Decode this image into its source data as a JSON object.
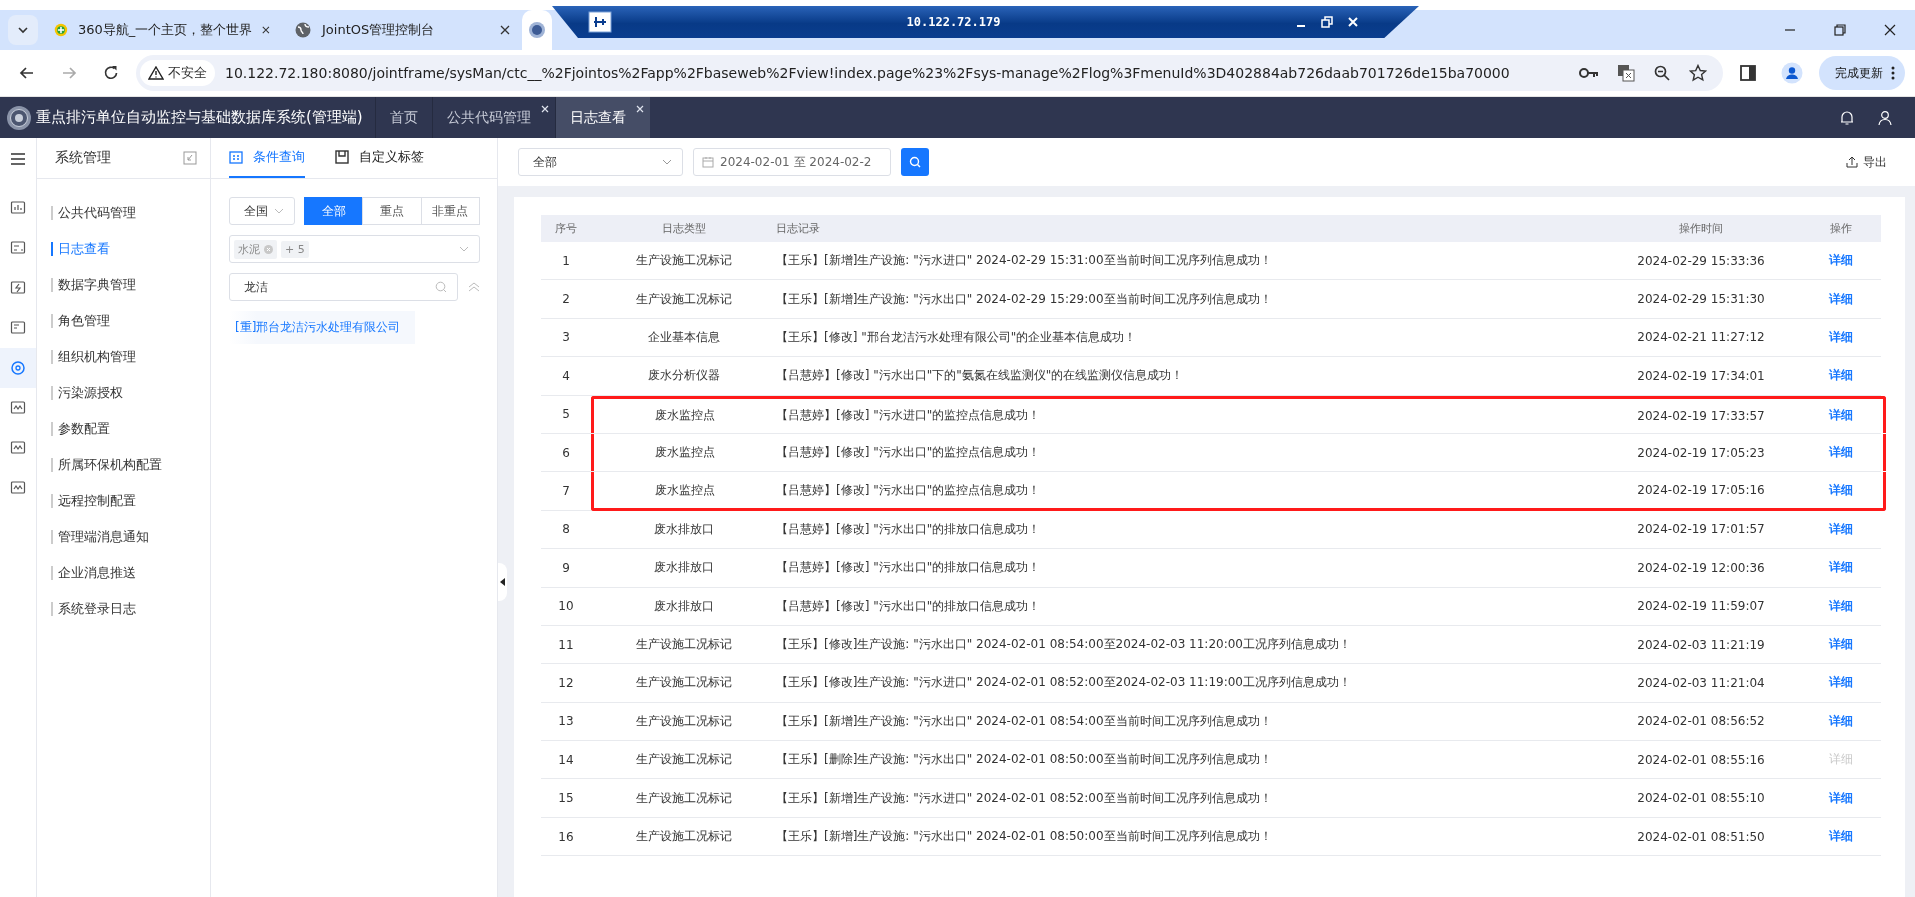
{
  "browser": {
    "tabs": [
      {
        "title": "360导航_一个主页，整个世界",
        "selected": false
      },
      {
        "title": "JointOS管理控制台",
        "selected": false
      },
      {
        "selected": true
      }
    ],
    "remote_bar": {
      "title": "10.122.72.179"
    },
    "address": {
      "security": "不安全",
      "url": "10.122.72.180:8080/jointframe/sysMan/ctc__%2Fjointos%2Fapp%2Fbaseweb%2Fview!index.page%23%2Fsys-manage%2Flog%3FmenuId%3D402884ab726daab701726de15ba70000"
    },
    "update_button": "完成更新"
  },
  "app": {
    "title": "重点排污单位自动监控与基础数据库系统(管理端)",
    "nav_tabs": [
      {
        "label": "首页",
        "closable": false,
        "selected": false
      },
      {
        "label": "公共代码管理",
        "closable": true,
        "selected": false
      },
      {
        "label": "日志查看",
        "closable": true,
        "selected": true
      }
    ]
  },
  "icon_rail": [
    {
      "selected": false
    },
    {
      "selected": false
    },
    {
      "selected": false
    },
    {
      "selected": false
    },
    {
      "selected": true
    },
    {
      "selected": false
    },
    {
      "selected": false
    },
    {
      "selected": false
    }
  ],
  "sidebar": {
    "title": "系统管理",
    "items": [
      {
        "label": "公共代码管理",
        "selected": false
      },
      {
        "label": "日志查看",
        "selected": true
      },
      {
        "label": "数据字典管理",
        "selected": false
      },
      {
        "label": "角色管理",
        "selected": false
      },
      {
        "label": "组织机构管理",
        "selected": false
      },
      {
        "label": "污染源授权",
        "selected": false
      },
      {
        "label": "参数配置",
        "selected": false
      },
      {
        "label": "所属环保机构配置",
        "selected": false
      },
      {
        "label": "远程控制配置",
        "selected": false
      },
      {
        "label": "管理端消息通知",
        "selected": false
      },
      {
        "label": "企业消息推送",
        "selected": false
      },
      {
        "label": "系统登录日志",
        "selected": false
      }
    ]
  },
  "filter_panel": {
    "tabs": [
      {
        "label": "条件查询",
        "selected": true
      },
      {
        "label": "自定义标签",
        "selected": false
      }
    ],
    "region": "全国",
    "segments": [
      {
        "label": "全部",
        "selected": true
      },
      {
        "label": "重点",
        "selected": false
      },
      {
        "label": "非重点",
        "selected": false
      }
    ],
    "tags": [
      {
        "label": "水泥"
      }
    ],
    "more_tags": "+ 5",
    "search": {
      "value": "龙洁"
    },
    "results": [
      {
        "label": "[重]邢台龙洁污水处理有限公司"
      }
    ]
  },
  "toolbar": {
    "type_select": "全部",
    "date_range": "2024-02-01 至 2024-02-2",
    "export": "导出"
  },
  "table": {
    "columns": [
      "序号",
      "日志类型",
      "日志记录",
      "操作时间",
      "操作"
    ],
    "rows": [
      {
        "no": "1",
        "type": "生产设施工况标记",
        "record": "【王乐】[新增]生产设施: \"污水进口\" 2024-02-29 15:31:00至当前时间工况序列信息成功！",
        "time": "2024-02-29 15:33:36",
        "action": "详细",
        "disabled": false,
        "highlighted": false
      },
      {
        "no": "2",
        "type": "生产设施工况标记",
        "record": "【王乐】[新增]生产设施: \"污水出口\" 2024-02-29 15:29:00至当前时间工况序列信息成功！",
        "time": "2024-02-29 15:31:30",
        "action": "详细",
        "disabled": false,
        "highlighted": false
      },
      {
        "no": "3",
        "type": "企业基本信息",
        "record": "【王乐】[修改] \"邢台龙洁污水处理有限公司\"的企业基本信息成功！",
        "time": "2024-02-21 11:27:12",
        "action": "详细",
        "disabled": false,
        "highlighted": false
      },
      {
        "no": "4",
        "type": "废水分析仪器",
        "record": "【吕慧婷】[修改] \"污水出口\"下的\"氨氮在线监测仪\"的在线监测仪信息成功！",
        "time": "2024-02-19 17:34:01",
        "action": "详细",
        "disabled": false,
        "highlighted": false
      },
      {
        "no": "5",
        "type": "废水监控点",
        "record": "【吕慧婷】[修改] \"污水进口\"的监控点信息成功！",
        "time": "2024-02-19 17:33:57",
        "action": "详细",
        "disabled": false,
        "highlighted": true
      },
      {
        "no": "6",
        "type": "废水监控点",
        "record": "【吕慧婷】[修改] \"污水出口\"的监控点信息成功！",
        "time": "2024-02-19 17:05:23",
        "action": "详细",
        "disabled": false,
        "highlighted": true
      },
      {
        "no": "7",
        "type": "废水监控点",
        "record": "【吕慧婷】[修改] \"污水出口\"的监控点信息成功！",
        "time": "2024-02-19 17:05:16",
        "action": "详细",
        "disabled": false,
        "highlighted": true
      },
      {
        "no": "8",
        "type": "废水排放口",
        "record": "【吕慧婷】[修改] \"污水出口\"的排放口信息成功！",
        "time": "2024-02-19 17:01:57",
        "action": "详细",
        "disabled": false,
        "highlighted": false
      },
      {
        "no": "9",
        "type": "废水排放口",
        "record": "【吕慧婷】[修改] \"污水出口\"的排放口信息成功！",
        "time": "2024-02-19 12:00:36",
        "action": "详细",
        "disabled": false,
        "highlighted": false
      },
      {
        "no": "10",
        "type": "废水排放口",
        "record": "【吕慧婷】[修改] \"污水出口\"的排放口信息成功！",
        "time": "2024-02-19 11:59:07",
        "action": "详细",
        "disabled": false,
        "highlighted": false
      },
      {
        "no": "11",
        "type": "生产设施工况标记",
        "record": "【王乐】[修改]生产设施: \"污水出口\" 2024-02-01 08:54:00至2024-02-03 11:20:00工况序列信息成功！",
        "time": "2024-02-03 11:21:19",
        "action": "详细",
        "disabled": false,
        "highlighted": false
      },
      {
        "no": "12",
        "type": "生产设施工况标记",
        "record": "【王乐】[修改]生产设施: \"污水进口\" 2024-02-01 08:52:00至2024-02-03 11:19:00工况序列信息成功！",
        "time": "2024-02-03 11:21:04",
        "action": "详细",
        "disabled": false,
        "highlighted": false
      },
      {
        "no": "13",
        "type": "生产设施工况标记",
        "record": "【王乐】[新增]生产设施: \"污水出口\" 2024-02-01 08:54:00至当前时间工况序列信息成功！",
        "time": "2024-02-01 08:56:52",
        "action": "详细",
        "disabled": false,
        "highlighted": false
      },
      {
        "no": "14",
        "type": "生产设施工况标记",
        "record": "【王乐】[删除]生产设施: \"污水出口\" 2024-02-01 08:50:00至当前时间工况序列信息成功！",
        "time": "2024-02-01 08:55:16",
        "action": "详细",
        "disabled": true,
        "highlighted": false
      },
      {
        "no": "15",
        "type": "生产设施工况标记",
        "record": "【王乐】[新增]生产设施: \"污水进口\" 2024-02-01 08:52:00至当前时间工况序列信息成功！",
        "time": "2024-02-01 08:55:10",
        "action": "详细",
        "disabled": false,
        "highlighted": false
      },
      {
        "no": "16",
        "type": "生产设施工况标记",
        "record": "【王乐】[新增]生产设施: \"污水出口\" 2024-02-01 08:50:00至当前时间工况序列信息成功！",
        "time": "2024-02-01 08:51:50",
        "action": "详细",
        "disabled": false,
        "highlighted": false
      }
    ]
  }
}
